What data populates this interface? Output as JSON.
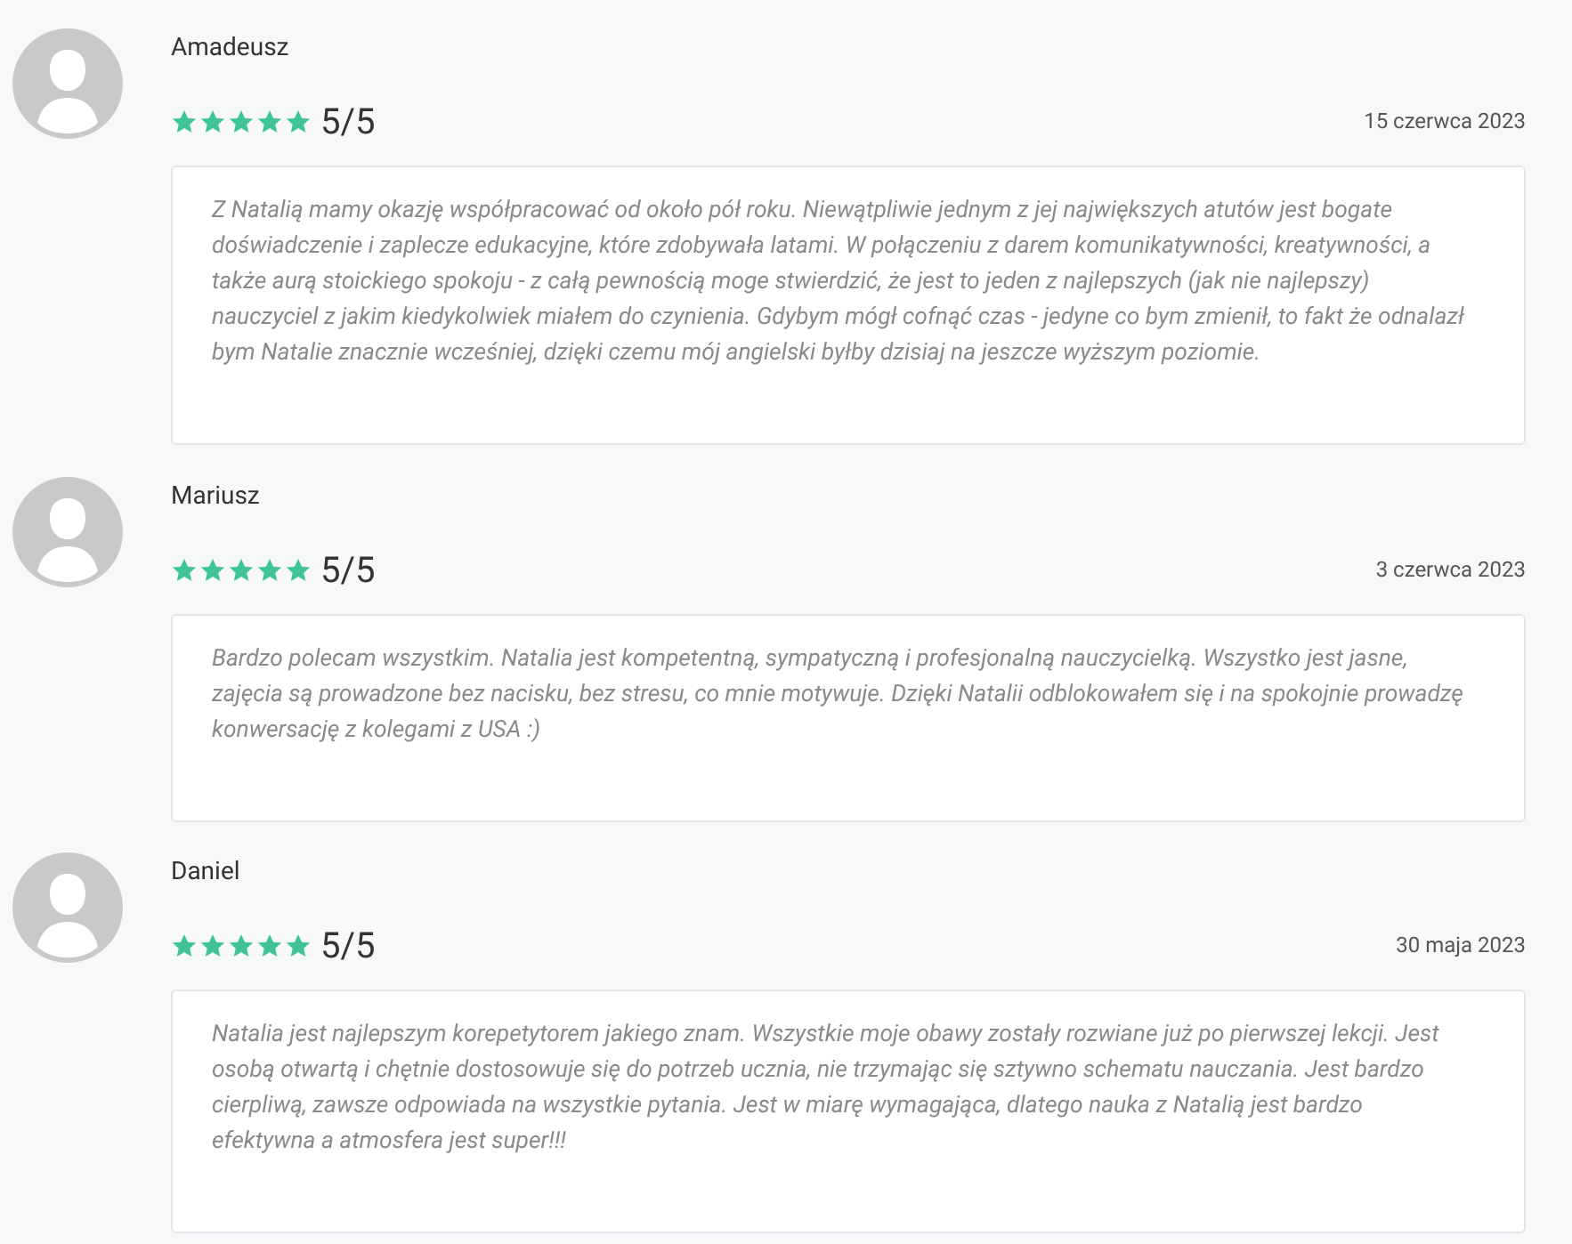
{
  "reviews": [
    {
      "name": "Amadeusz",
      "stars": 5,
      "rating": "5/5",
      "date": "15 czerwca 2023",
      "text": "Z Natalią mamy okazję współpracować od około pół roku. Niewątpliwie jednym z jej największych atutów jest bogate doświadczenie i zaplecze edukacyjne, które zdobywała latami. W połączeniu z darem komunikatywności, kreatywności, a także aurą stoickiego spokoju - z całą pewnością moge stwierdzić, że jest to jeden z najlepszych (jak nie najlepszy) nauczyciel z jakim kiedykolwiek miałem do czynienia. Gdybym mógł cofnąć czas - jedyne co bym zmienił, to fakt że odnalazł bym Natalie znacznie wcześniej, dzięki czemu mój angielski byłby dzisiaj na jeszcze wyższym poziomie."
    },
    {
      "name": "Mariusz",
      "stars": 5,
      "rating": "5/5",
      "date": "3 czerwca 2023",
      "text": "Bardzo polecam wszystkim. Natalia jest kompetentną, sympatyczną i profesjonalną nauczycielką. Wszystko jest jasne, zajęcia są prowadzone bez nacisku, bez stresu, co mnie motywuje. Dzięki Natalii odblokowałem się i na spokojnie prowadzę konwersację z kolegami z USA :)"
    },
    {
      "name": "Daniel",
      "stars": 5,
      "rating": "5/5",
      "date": "30 maja 2023",
      "text": "Natalia jest najlepszym korepetytorem jakiego znam. Wszystkie moje obawy zostały rozwiane już po pierwszej lekcji. Jest osobą otwartą i chętnie dostosowuje się do potrzeb ucznia, nie trzymając się sztywno schematu nauczania. Jest bardzo cierpliwą, zawsze odpowiada na wszystkie pytania. Jest w miarę wymagająca, dlatego nauka z Natalią jest bardzo efektywna a atmosfera jest super!!!"
    }
  ]
}
